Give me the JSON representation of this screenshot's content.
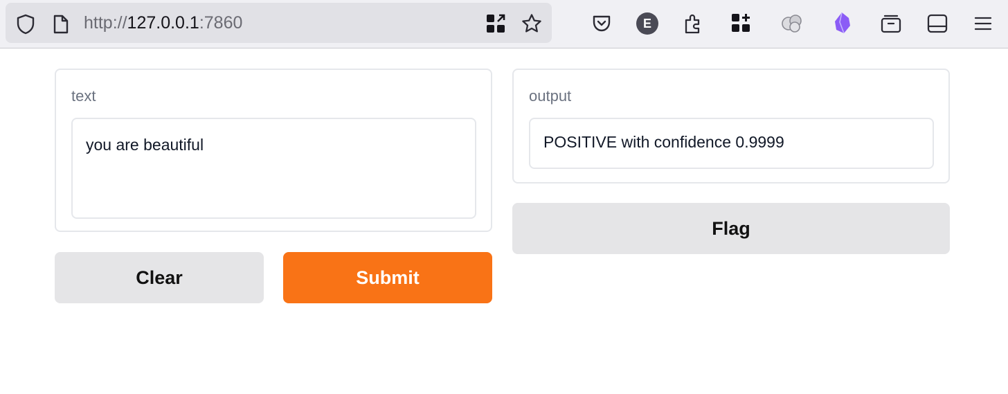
{
  "browser": {
    "url_scheme": "http://",
    "url_host": "127.0.0.1",
    "url_port": ":7860",
    "icons": [
      "shield-icon",
      "page-icon",
      "qr-code-icon",
      "bookmark-star-icon",
      "pocket-icon",
      "account-e-icon",
      "extensions-icon",
      "apps-grid-icon",
      "ai-assistant-icon",
      "obsidian-icon",
      "tab-tray-icon",
      "sidebar-icon",
      "hamburger-menu-icon"
    ],
    "account_letter": "E"
  },
  "input_panel": {
    "label": "text",
    "value": "you are beautiful"
  },
  "output_panel": {
    "label": "output",
    "value": "POSITIVE with confidence 0.9999"
  },
  "buttons": {
    "clear": "Clear",
    "submit": "Submit",
    "flag": "Flag"
  },
  "colors": {
    "primary": "#f97316",
    "secondary": "#e5e5e7",
    "border": "#e5e7eb"
  }
}
